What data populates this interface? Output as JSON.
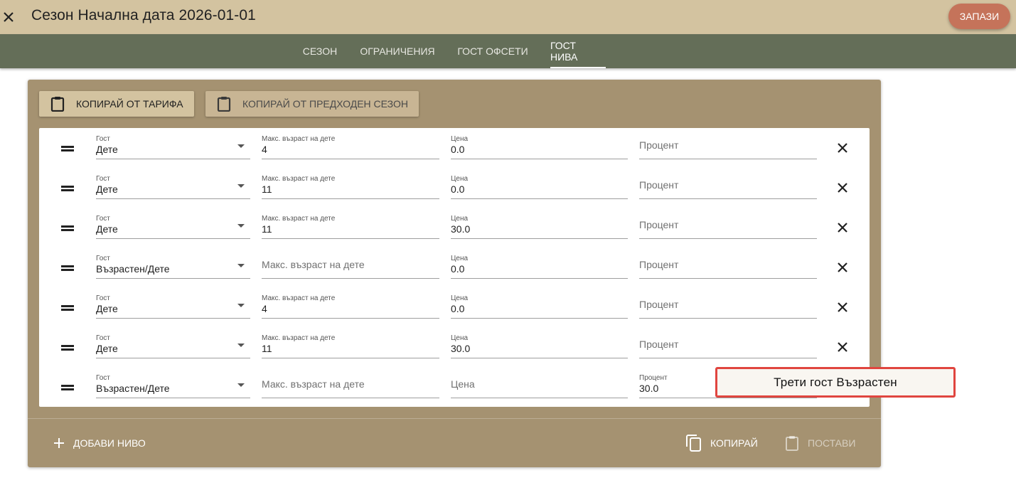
{
  "header": {
    "title": "Сезон Начална дата 2026-01-01",
    "save_label": "ЗАПАЗИ",
    "colors": {
      "topbar": "#d3c3a0",
      "save": "#c5735a",
      "tabbar": "#646e58"
    }
  },
  "tabs": [
    {
      "label": "СЕЗОН"
    },
    {
      "label": "ОГРАНИЧЕНИЯ"
    },
    {
      "label": "ГОСТ ОФСЕТИ"
    },
    {
      "label": "ГОСТ НИВА",
      "active": true
    }
  ],
  "toolbar": {
    "copy_from_tariff": "КОПИРАЙ ОТ ТАРИФА",
    "copy_from_previous": "КОПИРАЙ ОТ ПРЕДХОДЕН СЕЗОН"
  },
  "field_labels": {
    "guest": "Гост",
    "max_child_age": "Макс. възраст на дете",
    "price": "Цена",
    "percent": "Процент"
  },
  "rows": [
    {
      "guest": "Дете",
      "age": "4",
      "price": "0.0",
      "percent": ""
    },
    {
      "guest": "Дете",
      "age": "11",
      "price": "0.0",
      "percent": ""
    },
    {
      "guest": "Дете",
      "age": "11",
      "price": "30.0",
      "percent": ""
    },
    {
      "guest": "Възрастен/Дете",
      "age": "",
      "price": "0.0",
      "percent": ""
    },
    {
      "guest": "Дете",
      "age": "4",
      "price": "0.0",
      "percent": ""
    },
    {
      "guest": "Дете",
      "age": "11",
      "price": "30.0",
      "percent": ""
    },
    {
      "guest": "Възрастен/Дете",
      "age": "",
      "price": "",
      "percent": "30.0"
    }
  ],
  "footer": {
    "add_level": "ДОБАВИ НИВО",
    "copy": "КОПИРАЙ",
    "paste": "ПОСТАВИ"
  },
  "tooltip": {
    "text": "Трети гост Възрастен"
  }
}
